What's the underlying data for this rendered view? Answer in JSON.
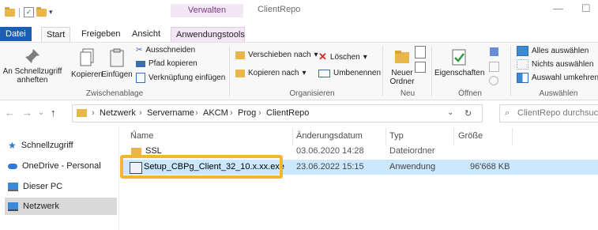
{
  "window": {
    "title": "ClientRepo",
    "context_tab": "Verwalten",
    "controls": {
      "minimize": "—",
      "maximize": "☐"
    }
  },
  "tabs": {
    "file": "Datei",
    "start": "Start",
    "share": "Freigeben",
    "view": "Ansicht",
    "app_tools": "Anwendungstools"
  },
  "ribbon": {
    "clipboard": {
      "pin_label_1": "An Schnellzugriff",
      "pin_label_2": "anheften",
      "copy": "Kopieren",
      "paste": "Einfügen",
      "cut": "Ausschneiden",
      "copy_path": "Pfad kopieren",
      "paste_shortcut": "Verknüpfung einfügen",
      "group": "Zwischenablage"
    },
    "organize": {
      "move_to": "Verschieben nach",
      "copy_to": "Kopieren nach",
      "delete": "Löschen",
      "rename": "Umbenennen",
      "group": "Organisieren"
    },
    "new": {
      "new_folder_1": "Neuer",
      "new_folder_2": "Ordner",
      "group": "Neu"
    },
    "open": {
      "properties": "Eigenschaften",
      "group": "Öffnen"
    },
    "select": {
      "select_all": "Alles auswählen",
      "select_none": "Nichts auswählen",
      "invert": "Auswahl umkehren",
      "group": "Auswählen"
    }
  },
  "address": {
    "crumbs": [
      "Netzwerk",
      "Servername",
      "AKCM",
      "Prog",
      "ClientRepo"
    ],
    "separator": "›",
    "search_placeholder": "ClientRepo durchsuchen"
  },
  "sidebar": {
    "items": [
      {
        "label": "Schnellzugriff",
        "icon": "star-icon"
      },
      {
        "label": "OneDrive - Personal",
        "icon": "cloud-icon"
      },
      {
        "label": "Dieser PC",
        "icon": "pc-icon"
      },
      {
        "label": "Netzwerk",
        "icon": "network-icon"
      }
    ]
  },
  "columns": {
    "name": "Name",
    "date": "Änderungsdatum",
    "type": "Typ",
    "size": "Größe"
  },
  "files": [
    {
      "name": "SSL",
      "date": "03.06.2020 14:28",
      "type": "Dateiordner",
      "size": ""
    },
    {
      "name": "Setup_CBPg_Client_32_10.x.xx.exe",
      "date": "23.06.2022 15:15",
      "type": "Anwendung",
      "size": "96'668 KB"
    }
  ],
  "colors": {
    "accent": "#1a5fb4",
    "highlight": "#f2b630",
    "selection": "#cce8ff",
    "context": "#f3e7f6"
  }
}
